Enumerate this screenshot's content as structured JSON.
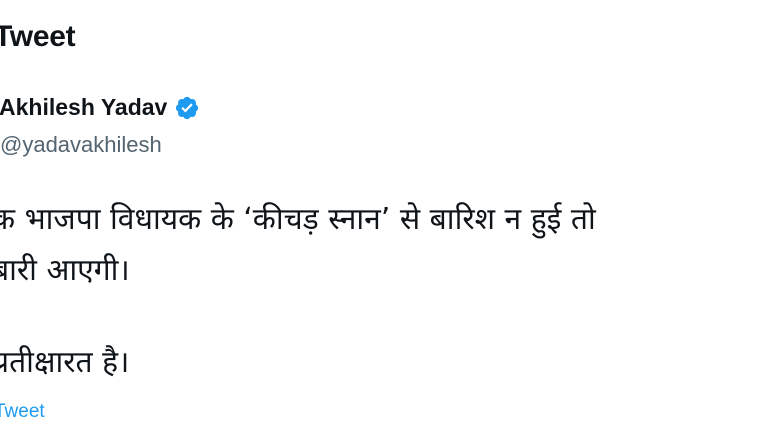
{
  "header": {
    "title": "Tweet"
  },
  "author": {
    "name": "Akhilesh Yadav",
    "handle": "@yadavakhilesh",
    "verified_icon": "verified-badge-icon",
    "verified_color": "#1d9bf0"
  },
  "tweet": {
    "lines": [
      "क भाजपा विधायक के ‘कीचड़ स्नान’ से बारिश न हुई तो",
      "बारी आएगी।",
      "प्रतीक्षारत है।"
    ]
  },
  "footer": {
    "link_text": "Tweet"
  },
  "colors": {
    "text": "#0f1419",
    "secondary": "#536471",
    "accent": "#1d9bf0"
  }
}
